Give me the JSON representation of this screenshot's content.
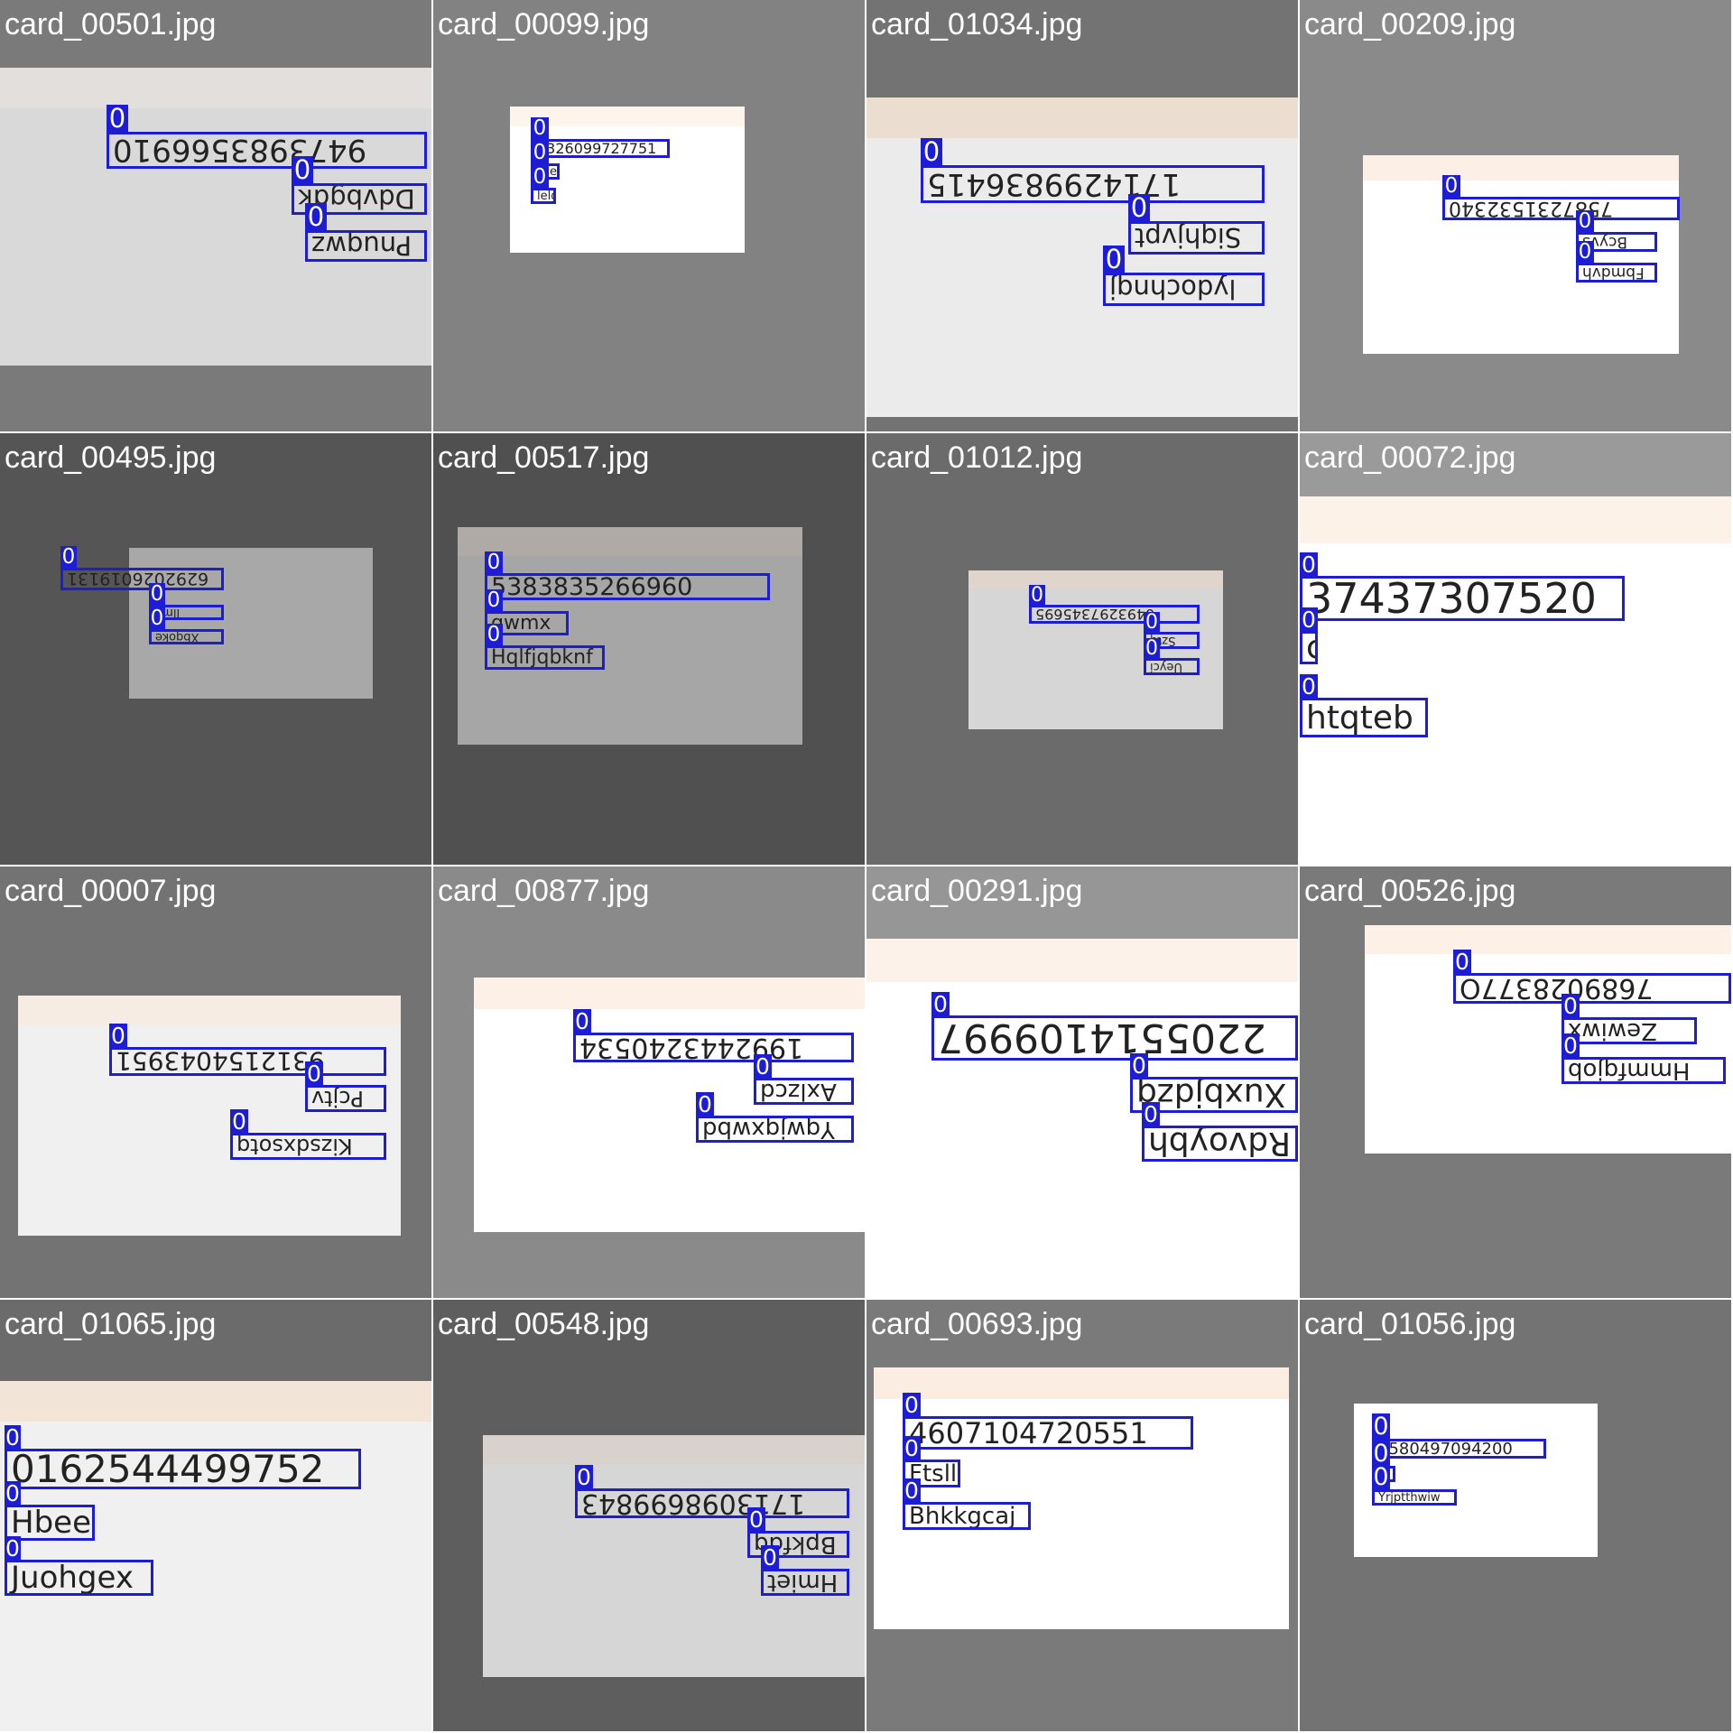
{
  "gallery": {
    "box_color": "#1d1dd6",
    "title_color": "#ffffff",
    "tiles": [
      {
        "file": "card_00501.jpg",
        "bg": "#7a7a7a",
        "card_color": "#d9d9d9",
        "band_color": "#e2dfdc",
        "detections": [
          {
            "label": "0",
            "text": "9473983566910",
            "flip": true
          },
          {
            "label": "0",
            "text": "Ddvbgdk",
            "flip": true
          },
          {
            "label": "0",
            "text": "Pnuqwz",
            "flip": true
          }
        ]
      },
      {
        "file": "card_00099.jpg",
        "bg": "#828282",
        "card_color": "#ffffff",
        "band_color": "#fdf5ec",
        "detections": [
          {
            "label": "0",
            "text": "0326099727751",
            "flip": false
          },
          {
            "label": "0",
            "text": "zce",
            "flip": false
          },
          {
            "label": "0",
            "text": "lelgl",
            "flip": false
          }
        ]
      },
      {
        "file": "card_01034.jpg",
        "bg": "#737373",
        "card_color": "#ebebeb",
        "band_color": "#ebddd0",
        "detections": [
          {
            "label": "0",
            "text": "1714299836415",
            "flip": true
          },
          {
            "label": "0",
            "text": "Siqhjvpt",
            "flip": true
          },
          {
            "label": "0",
            "text": "lydochnqj",
            "flip": true
          }
        ]
      },
      {
        "file": "card_00209.jpg",
        "bg": "#8a8a8a",
        "card_color": "#ffffff",
        "band_color": "#fcefe5",
        "detections": [
          {
            "label": "0",
            "text": "7587231532340",
            "flip": true
          },
          {
            "label": "0",
            "text": "Bcyvs",
            "flip": true
          },
          {
            "label": "0",
            "text": "Fbmdvh",
            "flip": true
          }
        ]
      },
      {
        "file": "card_00495.jpg",
        "bg": "#555555",
        "card_color": "#a8a8a8",
        "band_color": "#b8b4b0",
        "detections": [
          {
            "label": "0",
            "text": "6292026019131",
            "flip": true
          },
          {
            "label": "0",
            "text": "llmil",
            "flip": true
          },
          {
            "label": "0",
            "text": "Xbqoke",
            "flip": true
          }
        ]
      },
      {
        "file": "card_00517.jpg",
        "bg": "#505050",
        "card_color": "#a6a6a6",
        "band_color": "#b0aaa6",
        "detections": [
          {
            "label": "0",
            "text": "5383835266960",
            "flip": false
          },
          {
            "label": "0",
            "text": "qwmx",
            "flip": false
          },
          {
            "label": "0",
            "text": "Hqlfjqbknf",
            "flip": false
          }
        ]
      },
      {
        "file": "card_01012.jpg",
        "bg": "#6b6b6b",
        "card_color": "#d6d6d6",
        "band_color": "#dfd5cc",
        "detections": [
          {
            "label": "0",
            "text": "6493297345695",
            "flip": true
          },
          {
            "label": "0",
            "text": "Sztq",
            "flip": true
          },
          {
            "label": "0",
            "text": "Ueyci",
            "flip": true
          }
        ]
      },
      {
        "file": "card_00072.jpg",
        "bg": "#9a9a9a",
        "card_color": "#ffffff",
        "band_color": "#fdf2e8",
        "detections": [
          {
            "label": "0",
            "text": "37437307520",
            "flip": false
          },
          {
            "label": "0",
            "text": "c",
            "flip": false
          },
          {
            "label": "0",
            "text": "htqteb",
            "flip": false
          }
        ]
      },
      {
        "file": "card_00007.jpg",
        "bg": "#737373",
        "card_color": "#f0f0f0",
        "band_color": "#f7ece3",
        "detections": [
          {
            "label": "0",
            "text": "9312154043951",
            "flip": true
          },
          {
            "label": "0",
            "text": "Pcjtv",
            "flip": true
          },
          {
            "label": "0",
            "text": "Kizsdxsotq",
            "flip": true
          }
        ]
      },
      {
        "file": "card_00877.jpg",
        "bg": "#8a8a8a",
        "card_color": "#ffffff",
        "band_color": "#fdf1e7",
        "detections": [
          {
            "label": "0",
            "text": "1992443240534",
            "flip": true
          },
          {
            "label": "0",
            "text": "Axlzcd",
            "flip": true
          },
          {
            "label": "0",
            "text": "Yqwjqxwbd",
            "flip": true
          }
        ]
      },
      {
        "file": "card_00291.jpg",
        "bg": "#969696",
        "card_color": "#ffffff",
        "band_color": "#fdf2e9",
        "detections": [
          {
            "label": "0",
            "text": "2205514109997",
            "flip": true
          },
          {
            "label": "0",
            "text": "Xuxbjdzq",
            "flip": true
          },
          {
            "label": "0",
            "text": "Rdvoybh",
            "flip": true
          }
        ]
      },
      {
        "file": "card_00526.jpg",
        "bg": "#7a7a7a",
        "card_color": "#ffffff",
        "band_color": "#fdf1e7",
        "detections": [
          {
            "label": "0",
            "text": "7689028377O",
            "flip": true
          },
          {
            "label": "0",
            "text": "Zewiwx",
            "flip": true
          },
          {
            "label": "0",
            "text": "Hmmfqjob",
            "flip": true
          }
        ]
      },
      {
        "file": "card_01065.jpg",
        "bg": "#6b6b6b",
        "card_color": "#f0f0f0",
        "band_color": "#f3e4d8",
        "detections": [
          {
            "label": "0",
            "text": "0162544499752",
            "flip": false
          },
          {
            "label": "0",
            "text": "Hbee",
            "flip": false
          },
          {
            "label": "0",
            "text": "Juohgex",
            "flip": false
          }
        ]
      },
      {
        "file": "card_00548.jpg",
        "bg": "#5e5e5e",
        "card_color": "#d6d6d6",
        "band_color": "#d9d2cc",
        "detections": [
          {
            "label": "0",
            "text": "1713098699843",
            "flip": true
          },
          {
            "label": "0",
            "text": "Bpkfdq",
            "flip": true
          },
          {
            "label": "0",
            "text": "Hmiet",
            "flip": true
          }
        ]
      },
      {
        "file": "card_00693.jpg",
        "bg": "#7a7a7a",
        "card_color": "#ffffff",
        "band_color": "#fcede2",
        "detections": [
          {
            "label": "0",
            "text": "4607104720551",
            "flip": false
          },
          {
            "label": "0",
            "text": "Ftsll",
            "flip": false
          },
          {
            "label": "0",
            "text": "Bhkkgcaj",
            "flip": false
          }
        ]
      },
      {
        "file": "card_01056.jpg",
        "bg": "#737373",
        "card_color": "#ffffff",
        "band_color": "#ffffff",
        "detections": [
          {
            "label": "0",
            "text": "1580497094200",
            "flip": false
          },
          {
            "label": "0",
            "text": "ru",
            "flip": false
          },
          {
            "label": "0",
            "text": "Yrjptthwiw",
            "flip": false
          }
        ]
      }
    ]
  }
}
